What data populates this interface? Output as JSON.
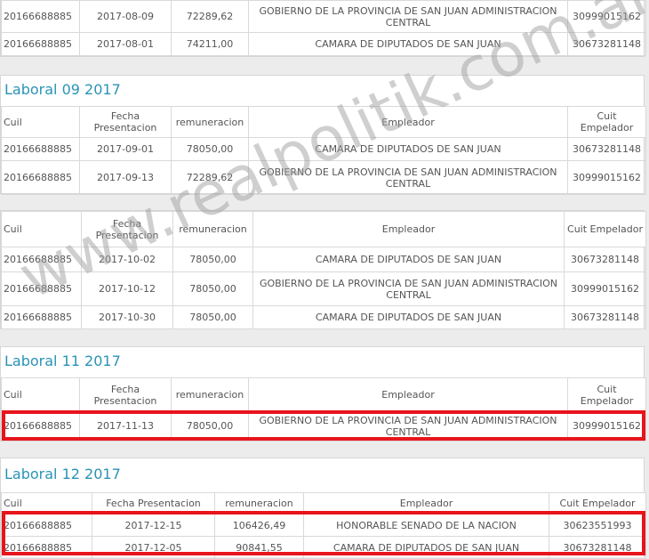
{
  "headers": {
    "cuil": "Cuil",
    "fecha": "Fecha Presentacion",
    "remuneracion": "remuneracion",
    "empleador": "Empleador",
    "cuit": "Cuit Empelador"
  },
  "watermark": "www.realpolitik.com.ar",
  "panel_08": {
    "rows": [
      {
        "cuil": "20166688885",
        "fecha": "2017-08-09",
        "rem": "72289,62",
        "emp": "GOBIERNO DE LA PROVINCIA DE SAN JUAN ADMINISTRACION CENTRAL",
        "cuit": "30999015162"
      },
      {
        "cuil": "20166688885",
        "fecha": "2017-08-01",
        "rem": "74211,00",
        "emp": "CAMARA DE DIPUTADOS DE SAN JUAN",
        "cuit": "30673281148"
      }
    ]
  },
  "panel_09": {
    "title": "Laboral 09 2017",
    "rows": [
      {
        "cuil": "20166688885",
        "fecha": "2017-09-01",
        "rem": "78050,00",
        "emp": "CAMARA DE DIPUTADOS DE SAN JUAN",
        "cuit": "30673281148"
      },
      {
        "cuil": "20166688885",
        "fecha": "2017-09-13",
        "rem": "72289,62",
        "emp": "GOBIERNO DE LA PROVINCIA DE SAN JUAN ADMINISTRACION CENTRAL",
        "cuit": "30999015162"
      }
    ]
  },
  "panel_10": {
    "rows": [
      {
        "cuil": "20166688885",
        "fecha": "2017-10-02",
        "rem": "78050,00",
        "emp": "CAMARA DE DIPUTADOS DE SAN JUAN",
        "cuit": "30673281148"
      },
      {
        "cuil": "20166688885",
        "fecha": "2017-10-12",
        "rem": "78050,00",
        "emp": "GOBIERNO DE LA PROVINCIA DE SAN JUAN ADMINISTRACION CENTRAL",
        "cuit": "30999015162"
      },
      {
        "cuil": "20166688885",
        "fecha": "2017-10-30",
        "rem": "78050,00",
        "emp": "CAMARA DE DIPUTADOS DE SAN JUAN",
        "cuit": "30673281148"
      }
    ]
  },
  "panel_11": {
    "title": "Laboral 11 2017",
    "rows": [
      {
        "cuil": "20166688885",
        "fecha": "2017-11-13",
        "rem": "78050,00",
        "emp": "GOBIERNO DE LA PROVINCIA DE SAN JUAN ADMINISTRACION CENTRAL",
        "cuit": "30999015162"
      }
    ]
  },
  "panel_12": {
    "title": "Laboral 12 2017",
    "rows": [
      {
        "cuil": "20166688885",
        "fecha": "2017-12-15",
        "rem": "106426,49",
        "emp": "HONORABLE SENADO DE LA NACION",
        "cuit": "30623551993"
      },
      {
        "cuil": "20166688885",
        "fecha": "2017-12-05",
        "rem": "90841,55",
        "emp": "CAMARA DE DIPUTADOS DE SAN JUAN",
        "cuit": "30673281148"
      }
    ]
  },
  "colors": {
    "accent": "#2a93b6",
    "highlight": "#e8141c"
  }
}
